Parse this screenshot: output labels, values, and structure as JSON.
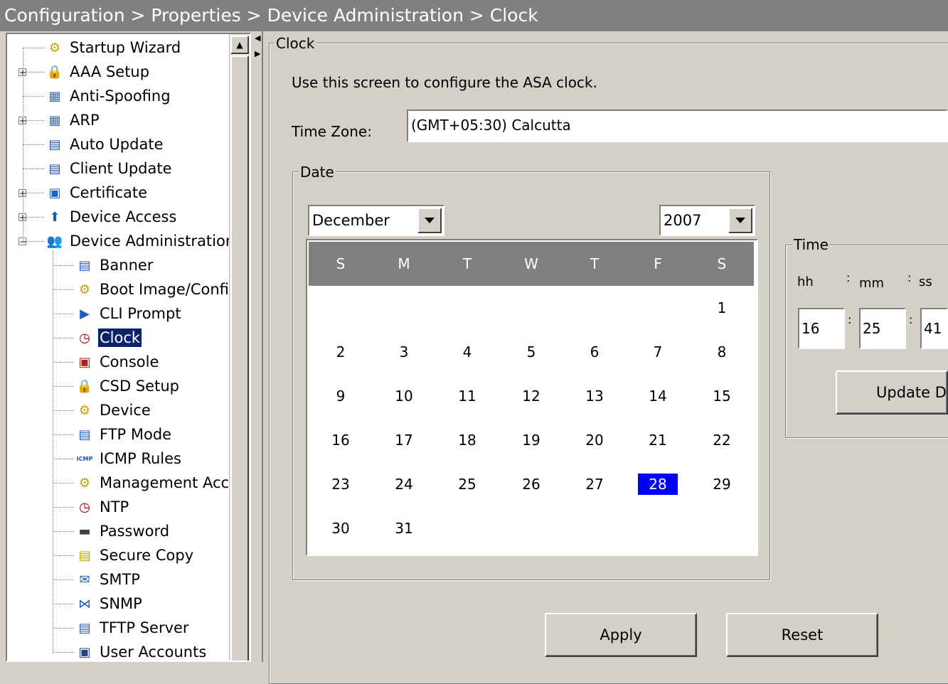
{
  "breadcrumb": "Configuration > Properties > Device Administration > Clock",
  "tree": [
    {
      "label": "Startup Wizard",
      "icon": "wizard-icon",
      "glyph": "⚙",
      "color": "#c8a000",
      "level": 0,
      "expander": ""
    },
    {
      "label": "AAA Setup",
      "icon": "lock-icon",
      "glyph": "🔒",
      "color": "#1040a0",
      "level": 0,
      "expander": "+"
    },
    {
      "label": "Anti-Spoofing",
      "icon": "anti-spoofing-icon",
      "glyph": "▦",
      "color": "#3a6ea5",
      "level": 0,
      "expander": ""
    },
    {
      "label": "ARP",
      "icon": "arp-icon",
      "glyph": "▦",
      "color": "#3a6ea5",
      "level": 0,
      "expander": "+"
    },
    {
      "label": "Auto Update",
      "icon": "auto-update-icon",
      "glyph": "▤",
      "color": "#2050a0",
      "level": 0,
      "expander": ""
    },
    {
      "label": "Client Update",
      "icon": "client-update-icon",
      "glyph": "▤",
      "color": "#2050a0",
      "level": 0,
      "expander": ""
    },
    {
      "label": "Certificate",
      "icon": "certificate-icon",
      "glyph": "▣",
      "color": "#2060c0",
      "level": 0,
      "expander": "+"
    },
    {
      "label": "Device Access",
      "icon": "device-access-icon",
      "glyph": "⬆",
      "color": "#1060c0",
      "level": 0,
      "expander": "+"
    },
    {
      "label": "Device Administration",
      "icon": "device-administration-icon",
      "glyph": "👥",
      "color": "#806040",
      "level": 0,
      "expander": "−"
    },
    {
      "label": "Banner",
      "icon": "banner-icon",
      "glyph": "▤",
      "color": "#2060c0",
      "level": 1,
      "expander": ""
    },
    {
      "label": "Boot Image/Config",
      "icon": "boot-image-icon",
      "glyph": "⚙",
      "color": "#c8a000",
      "level": 1,
      "expander": ""
    },
    {
      "label": "CLI Prompt",
      "icon": "cli-prompt-icon",
      "glyph": "▶",
      "color": "#2060c0",
      "level": 1,
      "expander": ""
    },
    {
      "label": "Clock",
      "icon": "clock-icon",
      "glyph": "◷",
      "color": "#a00000",
      "level": 1,
      "expander": "",
      "selected": true
    },
    {
      "label": "Console",
      "icon": "console-icon",
      "glyph": "▣",
      "color": "#b02020",
      "level": 1,
      "expander": ""
    },
    {
      "label": "CSD Setup",
      "icon": "csd-setup-icon",
      "glyph": "🔒",
      "color": "#c8a000",
      "level": 1,
      "expander": ""
    },
    {
      "label": "Device",
      "icon": "device-icon",
      "glyph": "⚙",
      "color": "#c8a000",
      "level": 1,
      "expander": ""
    },
    {
      "label": "FTP Mode",
      "icon": "ftp-mode-icon",
      "glyph": "▤",
      "color": "#2060c0",
      "level": 1,
      "expander": ""
    },
    {
      "label": "ICMP Rules",
      "icon": "icmp-rules-icon",
      "glyph": "ICMP",
      "color": "#2050c0",
      "level": 1,
      "expander": ""
    },
    {
      "label": "Management Access",
      "icon": "management-access-icon",
      "glyph": "⚙",
      "color": "#c8a000",
      "level": 1,
      "expander": ""
    },
    {
      "label": "NTP",
      "icon": "ntp-icon",
      "glyph": "◷",
      "color": "#a00000",
      "level": 1,
      "expander": ""
    },
    {
      "label": "Password",
      "icon": "password-icon",
      "glyph": "▬",
      "color": "#404040",
      "level": 1,
      "expander": ""
    },
    {
      "label": "Secure Copy",
      "icon": "secure-copy-icon",
      "glyph": "▤",
      "color": "#c8a000",
      "level": 1,
      "expander": ""
    },
    {
      "label": "SMTP",
      "icon": "smtp-icon",
      "glyph": "✉",
      "color": "#2060c0",
      "level": 1,
      "expander": ""
    },
    {
      "label": "SNMP",
      "icon": "snmp-icon",
      "glyph": "⋈",
      "color": "#2060c0",
      "level": 1,
      "expander": ""
    },
    {
      "label": "TFTP Server",
      "icon": "tftp-server-icon",
      "glyph": "▤",
      "color": "#2060c0",
      "level": 1,
      "expander": ""
    },
    {
      "label": "User Accounts",
      "icon": "user-accounts-icon",
      "glyph": "▣",
      "color": "#204080",
      "level": 1,
      "expander": ""
    }
  ],
  "clock": {
    "group_title": "Clock",
    "description": "Use this screen to configure the ASA clock.",
    "timezone_label": "Time Zone:",
    "timezone_value": "(GMT+05:30) Calcutta",
    "date_group_title": "Date",
    "month": "December",
    "year": "2007",
    "weekday_headers": [
      "S",
      "M",
      "T",
      "W",
      "T",
      "F",
      "S"
    ],
    "first_weekday_index": 6,
    "days_in_month": 31,
    "selected_day": 28,
    "time_group_title": "Time",
    "hh_label": "hh",
    "mm_label": "mm",
    "ss_label": "ss",
    "hh": "16",
    "mm": "25",
    "ss": "41",
    "update_button": "Update D",
    "apply_button": "Apply",
    "reset_button": "Reset"
  }
}
